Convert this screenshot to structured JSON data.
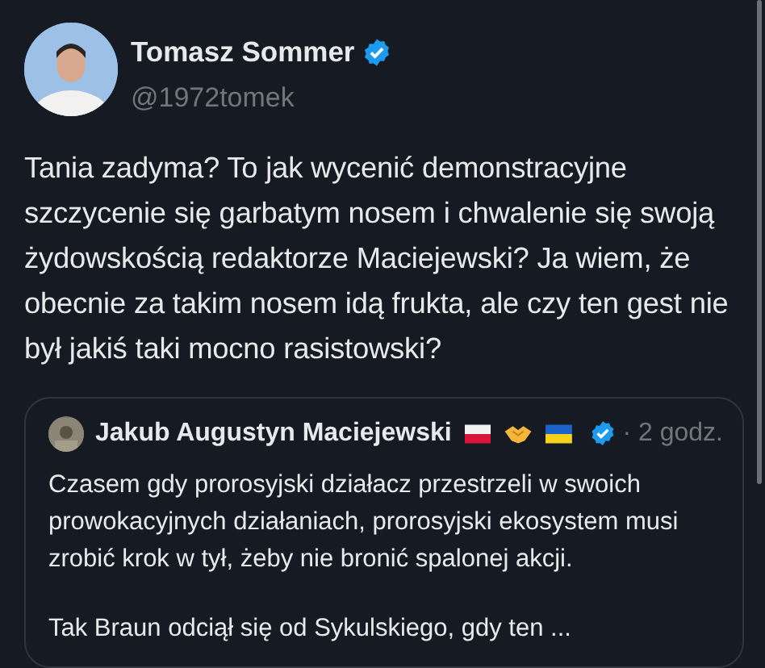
{
  "author": {
    "name": "Tomasz Sommer",
    "handle": "@1972tomek",
    "verified": true
  },
  "text": "Tania zadyma? To jak wycenić demonstracyjne szczycenie się garbatym nosem i chwalenie się swoją żydowskością redaktorze Maciejewski? Ja wiem, że obecnie za takim nosem idą frukta, ale czy ten gest nie był jakiś taki mocno rasistowski?",
  "quote": {
    "author": {
      "name": "Jakub Augustyn Maciejewski",
      "verified": true
    },
    "time": "· 2 godz.",
    "paragraphs": [
      "Czasem gdy prorosyjski działacz przestrzeli w swoich prowokacyjnych działaniach, prorosyjski ekosystem musi zrobić krok w tył, żeby nie bronić spalonej akcji.",
      "Tak Braun odciął się od Sykulskiego, gdy ten ..."
    ]
  }
}
